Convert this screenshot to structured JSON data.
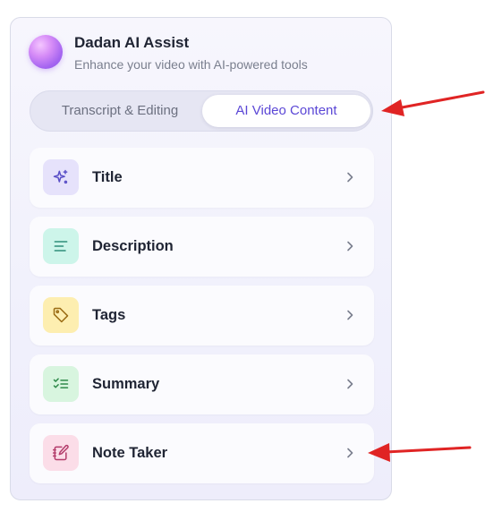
{
  "header": {
    "title": "Dadan AI Assist",
    "subtitle": "Enhance your video with AI-powered tools"
  },
  "tabs": [
    {
      "label": "Transcript & Editing",
      "active": false
    },
    {
      "label": "AI Video Content",
      "active": true
    }
  ],
  "items": [
    {
      "label": "Title",
      "icon": "sparkle-icon",
      "icon_bg": "#e6e2fb",
      "icon_color": "#5a4fc7"
    },
    {
      "label": "Description",
      "icon": "align-left-icon",
      "icon_bg": "#cdf5ea",
      "icon_color": "#2e8f7a"
    },
    {
      "label": "Tags",
      "icon": "tag-icon",
      "icon_bg": "#fdeeb0",
      "icon_color": "#9a6b12"
    },
    {
      "label": "Summary",
      "icon": "checklist-icon",
      "icon_bg": "#d8f5df",
      "icon_color": "#2f8a4a"
    },
    {
      "label": "Note Taker",
      "icon": "notebook-pen-icon",
      "icon_bg": "#fbdde8",
      "icon_color": "#b33c6b"
    }
  ],
  "colors": {
    "accent": "#5b47d6",
    "annotation_arrow": "#e02424"
  }
}
